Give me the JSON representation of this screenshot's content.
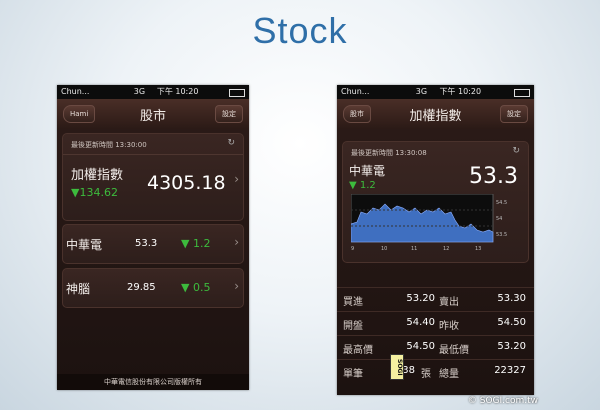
{
  "slide": {
    "title": "Stock"
  },
  "left_phone": {
    "status": {
      "carrier": "Chun...",
      "network": "3G",
      "time": "下午 10:20"
    },
    "nav": {
      "back": "Hami",
      "title": "股市",
      "settings": "設定"
    },
    "updated": "最後更新時間 13:30:00",
    "index": {
      "name": "加權指數",
      "value": "4305.18",
      "change": "134.62"
    },
    "rows": [
      {
        "name": "中華電",
        "price": "53.3",
        "change": "1.2"
      },
      {
        "name": "神腦",
        "price": "29.85",
        "change": "0.5"
      }
    ],
    "footer": "中華電信股份有限公司版權所有"
  },
  "right_phone": {
    "status": {
      "carrier": "Chun...",
      "network": "3G",
      "time": "下午 10:20"
    },
    "nav": {
      "back": "股市",
      "title": "加權指數",
      "settings": "設定"
    },
    "updated": "最後更新時間 13:30:08",
    "stock": {
      "name": "中華電",
      "price": "53.3",
      "change": "1.2"
    },
    "chart_ticks_x": [
      "9",
      "10",
      "11",
      "12",
      "13"
    ],
    "chart_ticks_y": [
      "54.5",
      "54",
      "53.5"
    ],
    "details": [
      {
        "l1": "買進",
        "v1": "53.20",
        "l2": "賣出",
        "v2": "53.30"
      },
      {
        "l1": "開盤",
        "v1": "54.40",
        "l2": "昨收",
        "v2": "54.50"
      },
      {
        "l1": "最高價",
        "v1": "54.50",
        "l2": "最低價",
        "v2": "53.20"
      },
      {
        "l1": "單筆",
        "v1": "838",
        "unit": "張",
        "l2": "總量",
        "v2": "22327"
      }
    ]
  },
  "watermark": "SOGI.com.tw",
  "logo_text": "SOGI",
  "colors": {
    "title": "#2f6fa8",
    "up_down_green": "#3dbb3d",
    "chart_fill": "#3f6fc0"
  }
}
